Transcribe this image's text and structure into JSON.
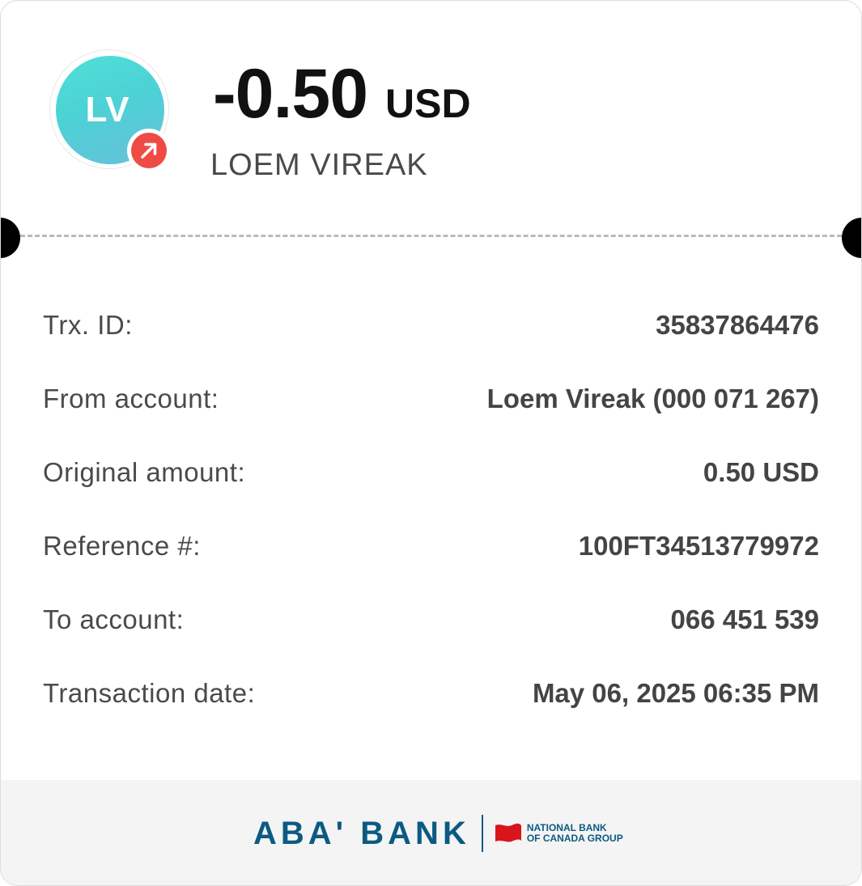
{
  "header": {
    "avatar_initials": "LV",
    "amount": "-0.50",
    "currency": "USD",
    "payee_name": "LOEM VIREAK",
    "direction_icon": "arrow-up-right-icon",
    "avatar_color": "#4fd9d6",
    "badge_color": "#ee4b45"
  },
  "details": [
    {
      "label": "Trx. ID:",
      "value": "35837864476"
    },
    {
      "label": "From account:",
      "value": "Loem Vireak (000 071 267)"
    },
    {
      "label": "Original amount:",
      "value": "0.50 USD"
    },
    {
      "label": "Reference #:",
      "value": "100FT34513779972"
    },
    {
      "label": "To account:",
      "value": "066 451 539"
    },
    {
      "label": "Transaction date:",
      "value": "May 06, 2025 06:35 PM"
    }
  ],
  "footer": {
    "bank_name": "ABA' BANK",
    "group_line1": "NATIONAL BANK",
    "group_line2": "OF CANADA GROUP",
    "brand_color": "#0c5a82",
    "flag_color": "#d9141b"
  }
}
